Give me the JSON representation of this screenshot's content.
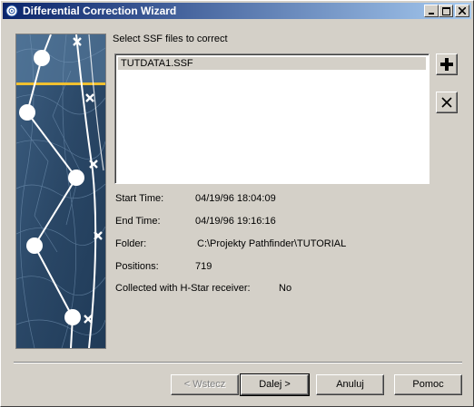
{
  "window": {
    "title": "Differential Correction Wizard",
    "title_icon": "app-globe-icon",
    "minimize_icon": "minimize-icon",
    "maximize_icon": "maximize-icon",
    "close_icon": "close-icon"
  },
  "files": {
    "prompt": "Select SSF files to correct",
    "items": [
      "TUTDATA1.SSF"
    ],
    "add_icon": "plus-icon",
    "remove_icon": "x-icon"
  },
  "details": {
    "start_time_label": "Start Time:",
    "start_time_value": "04/19/96 18:04:09",
    "end_time_label": "End Time:",
    "end_time_value": "04/19/96 19:16:16",
    "folder_label": "Folder:",
    "folder_value": "C:\\Projekty Pathfinder\\TUTORIAL",
    "positions_label": "Positions:",
    "positions_value": "719",
    "hstar_label": "Collected with H-Star receiver:",
    "hstar_value": "No"
  },
  "buttons": {
    "back": "< Wstecz",
    "next": "Dalej >",
    "cancel": "Anuluj",
    "help": "Pomoc"
  },
  "colors": {
    "titlebar_start": "#0a246a",
    "titlebar_end": "#a6caf0",
    "face": "#d4d0c8",
    "side_image_base": "#2c4a6b",
    "accent_line": "#f0c030"
  }
}
